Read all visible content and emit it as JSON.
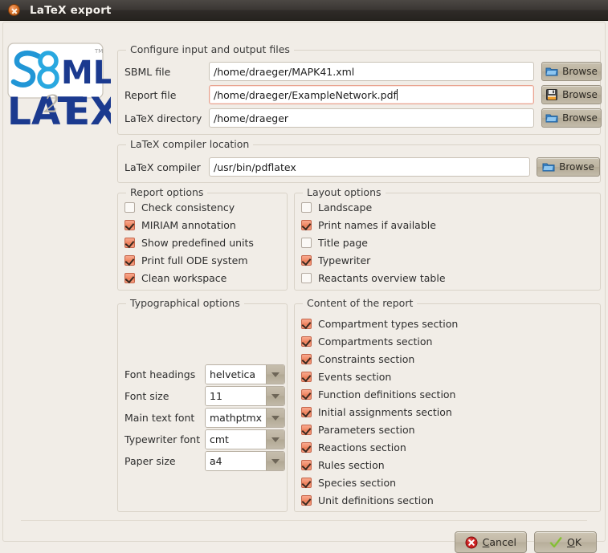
{
  "window": {
    "title": "LaTeX export",
    "close_icon": "close-icon"
  },
  "logo": {
    "alt": "SBML2LaTeX",
    "line1": "SBML",
    "line2": "LATEX",
    "subscript": "2",
    "trademark": "TM"
  },
  "files_group": {
    "title": "Configure input and output files",
    "rows": [
      {
        "label": "SBML file",
        "value": "/home/draeger/MAPK41.xml",
        "focused": false,
        "button": "Browse",
        "icon": "folder-icon"
      },
      {
        "label": "Report file",
        "value": "/home/draeger/ExampleNetwork.pdf",
        "focused": true,
        "button": "Browse",
        "icon": "floppy-save-icon"
      },
      {
        "label": "LaTeX directory",
        "value": "/home/draeger",
        "focused": false,
        "button": "Browse",
        "icon": "folder-icon"
      }
    ]
  },
  "compiler_group": {
    "title": "LaTeX compiler location",
    "rows": [
      {
        "label": "LaTeX compiler",
        "value": "/usr/bin/pdflatex",
        "focused": false,
        "button": "Browse",
        "icon": "folder-icon"
      }
    ]
  },
  "report_options": {
    "title": "Report options",
    "items": [
      {
        "label": "Check consistency",
        "checked": false
      },
      {
        "label": "MIRIAM annotation",
        "checked": true
      },
      {
        "label": "Show predefined units",
        "checked": true
      },
      {
        "label": "Print full ODE system",
        "checked": true
      },
      {
        "label": "Clean workspace",
        "checked": true
      }
    ]
  },
  "layout_options": {
    "title": "Layout options",
    "items": [
      {
        "label": "Landscape",
        "checked": false
      },
      {
        "label": "Print names if available",
        "checked": true
      },
      {
        "label": "Title page",
        "checked": false
      },
      {
        "label": "Typewriter",
        "checked": true
      },
      {
        "label": "Reactants overview table",
        "checked": false
      }
    ]
  },
  "typographical_options": {
    "title": "Typographical options",
    "rows": [
      {
        "label": "Font headings",
        "value": "helvetica"
      },
      {
        "label": "Font size",
        "value": "11"
      },
      {
        "label": "Main text font",
        "value": "mathptmx"
      },
      {
        "label": "Typewriter font",
        "value": "cmt"
      },
      {
        "label": "Paper size",
        "value": "a4"
      }
    ]
  },
  "content_options": {
    "title": "Content of the report",
    "items": [
      {
        "label": "Compartment types section",
        "checked": true
      },
      {
        "label": "Compartments section",
        "checked": true
      },
      {
        "label": "Constraints section",
        "checked": true
      },
      {
        "label": "Events section",
        "checked": true
      },
      {
        "label": "Function definitions section",
        "checked": true
      },
      {
        "label": "Initial assignments section",
        "checked": true
      },
      {
        "label": "Parameters section",
        "checked": true
      },
      {
        "label": "Reactions section",
        "checked": true
      },
      {
        "label": "Rules section",
        "checked": true
      },
      {
        "label": "Species section",
        "checked": true
      },
      {
        "label": "Unit definitions section",
        "checked": true
      }
    ]
  },
  "footer": {
    "cancel_label": "Cancel",
    "ok_label": "OK",
    "cancel_icon": "error-circle-x-icon",
    "ok_icon": "green-check-icon"
  },
  "colors": {
    "titlebar": "#3b3734",
    "background": "#f1ede7",
    "checkbox_checked": "#ec7b55",
    "focus_border": "#e8a390",
    "button_face": "#bdb4a1",
    "cancel_red": "#cc2222",
    "ok_green": "#8dc63f"
  }
}
